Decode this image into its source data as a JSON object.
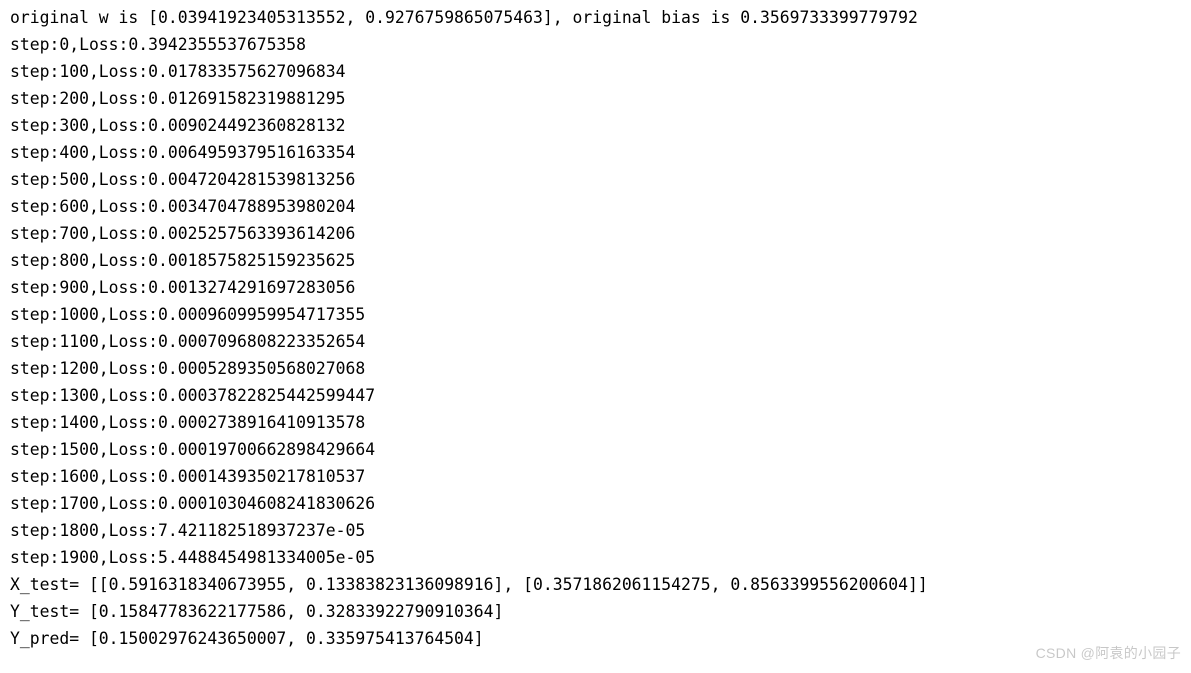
{
  "header": {
    "text": "original w is [0.03941923405313552, 0.9276759865075463], original bias is 0.3569733399779792"
  },
  "steps": [
    {
      "step": 0,
      "loss": "0.3942355537675358"
    },
    {
      "step": 100,
      "loss": "0.017833575627096834"
    },
    {
      "step": 200,
      "loss": "0.012691582319881295"
    },
    {
      "step": 300,
      "loss": "0.009024492360828132"
    },
    {
      "step": 400,
      "loss": "0.0064959379516163354"
    },
    {
      "step": 500,
      "loss": "0.0047204281539813256"
    },
    {
      "step": 600,
      "loss": "0.0034704788953980204"
    },
    {
      "step": 700,
      "loss": "0.0025257563393614206"
    },
    {
      "step": 800,
      "loss": "0.0018575825159235625"
    },
    {
      "step": 900,
      "loss": "0.0013274291697283056"
    },
    {
      "step": 1000,
      "loss": "0.0009609959954717355"
    },
    {
      "step": 1100,
      "loss": "0.0007096808223352654"
    },
    {
      "step": 1200,
      "loss": "0.0005289350568027068"
    },
    {
      "step": 1300,
      "loss": "0.00037822825442599447"
    },
    {
      "step": 1400,
      "loss": "0.0002738916410913578"
    },
    {
      "step": 1500,
      "loss": "0.00019700662898429664"
    },
    {
      "step": 1600,
      "loss": "0.0001439350217810537"
    },
    {
      "step": 1700,
      "loss": "0.00010304608241830626"
    },
    {
      "step": 1800,
      "loss": "7.421182518937237e-05"
    },
    {
      "step": 1900,
      "loss": "5.4488454981334005e-05"
    }
  ],
  "footer": {
    "x_test": "X_test= [[0.5916318340673955, 0.13383823136098916], [0.3571862061154275, 0.8563399556200604]]",
    "y_test": "Y_test= [0.15847783622177586, 0.32833922790910364]",
    "y_pred": "Y_pred= [0.15002976243650007, 0.335975413764504]"
  },
  "watermark": {
    "text": "CSDN @阿袁的小园子"
  }
}
